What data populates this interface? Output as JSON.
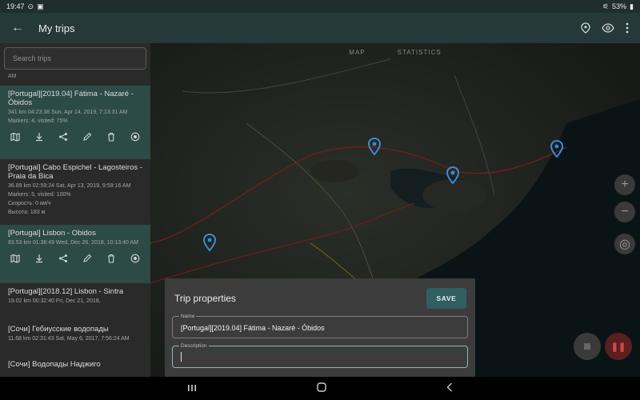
{
  "status": {
    "time": "19:47",
    "battery": "53%"
  },
  "appbar": {
    "title": "My trips"
  },
  "sidebar": {
    "search_placeholder": "Search trips",
    "top_fragment": "AM",
    "trips": [
      {
        "title": "[Portugal][2019.04] Fátima - Nazaré - Óbidos",
        "meta": [
          "341 km    04:23:38    Sun, Apr 14, 2019, 7:13:31 AM",
          "Markers: 4, visited: 75%"
        ],
        "selected": true,
        "has_actions": true
      },
      {
        "title": "[Portugal] Cabo Espichel - Lagosteiros - Praia da Bica",
        "meta": [
          "36.89 km    02:59:24    Sat, Apr 13, 2019, 9:59:16 AM",
          "Markers: 5, visited: 100%",
          "Скорость: 0 км/ч",
          "Высота: 183 м"
        ],
        "selected": false,
        "has_actions": false
      },
      {
        "title": "[Portugal] Lisbon - Obidos",
        "meta": [
          "83.53 km    01:38:49    Wed, Dec 26, 2018, 10:13:40 AM"
        ],
        "selected": true,
        "has_actions": true
      },
      {
        "title": "[Portugal][2018.12] Lisbon - Sintra",
        "meta": [
          "19.02 km    00:32:40    Fri, Dec 21, 2018,"
        ],
        "selected": false,
        "has_actions": false
      },
      {
        "title": "[Сочи] Гебиусские водопады",
        "meta": [
          "11.68 km    02:31:43    Sat, May 6, 2017, 7:56:24 AM"
        ],
        "selected": false,
        "has_actions": false
      },
      {
        "title": "[Сочи] Водопады Наджиго",
        "meta": [
          ""
        ],
        "selected": false,
        "has_actions": false
      }
    ]
  },
  "map": {
    "tabs": [
      "MAP",
      "STATISTICS"
    ]
  },
  "dialog": {
    "title": "Trip properties",
    "save_label": "SAVE",
    "name_label": "Name",
    "name_value": "[Portugal][2019.04] Fátima - Nazaré - Óbidos",
    "description_label": "Description",
    "description_value": ""
  },
  "colors": {
    "appbar": "#253938",
    "selected_row": "#2c4a46",
    "save_button": "#2f5e63",
    "focus_outline": "#8bb8b1"
  }
}
